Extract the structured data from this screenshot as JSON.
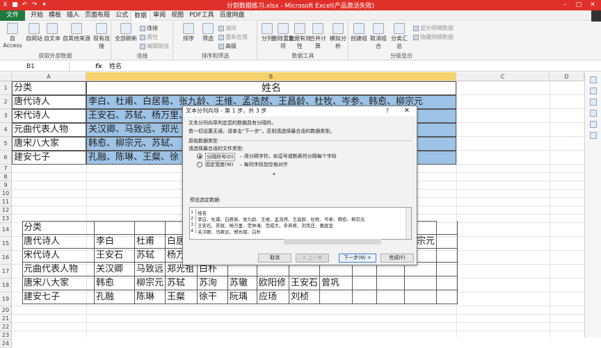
{
  "window": {
    "title": "分割数据练习.xlsx - Microsoft Excel(产品激活失败)",
    "qat_icons": [
      "excel-logo-icon",
      "save-icon",
      "undo-icon",
      "redo-icon",
      "dropdown-icon"
    ],
    "controls": [
      "–",
      "□",
      "✕"
    ]
  },
  "menu": {
    "file_label": "文件",
    "tabs": [
      "开始",
      "模板",
      "插入",
      "页面布局",
      "公式",
      "数据",
      "审阅",
      "视图",
      "PDF工具",
      "百度网盘"
    ]
  },
  "ribbon": {
    "external": {
      "label": "获取外部数据",
      "buttons": [
        "自 Access",
        "自网站",
        "自文本",
        "自其他来源",
        "现有连接"
      ]
    },
    "connections": {
      "label": "连接",
      "refresh": "全部刷新",
      "items": [
        "连接",
        "属性",
        "编辑链接"
      ]
    },
    "sort_filter": {
      "label": "排序和筛选",
      "sort": "排序",
      "filter": "筛选",
      "items": [
        "清除",
        "重新应用",
        "高级"
      ]
    },
    "data_tools": {
      "label": "数据工具",
      "buttons": [
        "分列",
        "删除重复项",
        "数据有效性",
        "合并计算",
        "模拟分析"
      ]
    },
    "outline": {
      "label": "分级显示",
      "buttons": [
        "创建组",
        "取消组合",
        "分类汇总"
      ],
      "items": [
        "显示明细数据",
        "隐藏明细数据"
      ]
    }
  },
  "formula_bar": {
    "name_box": "B1",
    "fx": "fx",
    "value": "姓名"
  },
  "columns": [
    "A",
    "B",
    "C",
    "D"
  ],
  "rows": [
    "1",
    "2",
    "3",
    "4",
    "5",
    "6",
    "7",
    "8",
    "9",
    "10",
    "11",
    "12",
    "13",
    "14",
    "15",
    "16",
    "17",
    "18",
    "19",
    "20",
    "21",
    "22",
    "23",
    "24"
  ],
  "table1": {
    "header_a": "分类",
    "header_b": "姓名",
    "rows": [
      {
        "a": "唐代诗人",
        "b": "李白、杜甫、白居易、张九龄、王维、孟浩然、王昌龄、杜牧、岑参、韩愈、柳宗元"
      },
      {
        "a": "宋代诗人",
        "b": "王安石、苏轼、杨万里、"
      },
      {
        "a": "元曲代表人物",
        "b": "关汉卿、马致远、郑光"
      },
      {
        "a": "唐宋八大家",
        "b": "韩愈、柳宗元、苏轼、"
      },
      {
        "a": "建安七子",
        "b": "孔融、陈琳、王粲、徐"
      }
    ]
  },
  "table2": {
    "header": "分类",
    "rows": [
      [
        "唐代诗人",
        "李白",
        "杜甫",
        "白居"
      ],
      [
        "宋代诗人",
        "王安石",
        "苏轼",
        "杨万"
      ],
      [
        "元曲代表人物",
        "关汉卿",
        "马致远",
        "郑光祖",
        "白朴"
      ],
      [
        "唐宋八大家",
        "韩愈",
        "柳宗元",
        "苏轼",
        "苏洵",
        "苏辙",
        "欧阳修",
        "王安石",
        "曾巩"
      ],
      [
        "建安七子",
        "孔融",
        "陈琳",
        "王粲",
        "徐干",
        "阮瑀",
        "应玚",
        "刘桢"
      ]
    ],
    "overflow_right": "宗元"
  },
  "dialog": {
    "title": "文本分列向导 - 第 1 步，共 3 步",
    "help": "?",
    "close": "✕",
    "intro1": "文本分列向导判定您的数据具有分隔符。",
    "intro2": "若一切设置无误，请单击“下一步”，否则请选择最合适的数据类型。",
    "section": "原始数据类型",
    "prompt": "请选择最合适的文件类型:",
    "opt1": "分隔符号(D)",
    "opt1_desc": "– 用分隔字符，如逗号或制表符分隔每个字段",
    "opt2": "固定宽度(W)",
    "opt2_desc": "– 每列字段加空格对齐",
    "preview_label": "预览选定数据:",
    "preview_lines": [
      {
        "n": "1",
        "t": "姓名"
      },
      {
        "n": "2",
        "t": "李白、杜甫、白居易、张九龄、王维、孟浩然、王昌龄、杜牧、岑参、韩愈、柳宗元"
      },
      {
        "n": "3",
        "t": "王安石、苏轼、杨万里、范仲淹、范成大、辛弃疾、刘克庄、黄庭坚"
      },
      {
        "n": "4",
        "t": "关汉卿、马致远、郑光祖、白朴"
      }
    ],
    "buttons": {
      "cancel": "取消",
      "back": "< 上一步",
      "next": "下一步(N) >",
      "finish": "完成(F)"
    }
  }
}
